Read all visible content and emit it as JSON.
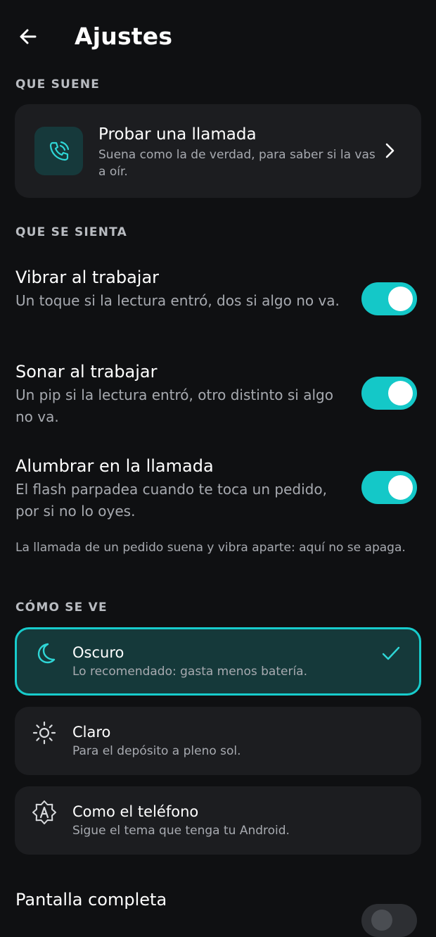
{
  "header": {
    "title": "Ajustes",
    "back_icon": "arrow-left-icon"
  },
  "sections": {
    "sound": "QUE SUENE",
    "feel": "QUE SE SIENTA",
    "look": "CÓMO SE VE"
  },
  "test_call": {
    "icon": "phone-ringing-icon",
    "title": "Probar una llamada",
    "subtitle": "Suena como la de verdad, para saber si la vas a oír."
  },
  "toggles": [
    {
      "title": "Vibrar al trabajar",
      "subtitle": "Un toque si la lectura entró, dos si algo no va.",
      "on": true
    },
    {
      "title": "Sonar al trabajar",
      "subtitle": "Un pip si la lectura entró, otro distinto si algo no va.",
      "on": true
    },
    {
      "title": "Alumbrar en la llamada",
      "subtitle": "El flash parpadea cuando te toca un pedido, por si no lo oyes.",
      "on": true
    }
  ],
  "note": "La llamada de un pedido suena y vibra aparte: aquí no se apaga.",
  "themes": [
    {
      "icon": "moon-icon",
      "title": "Oscuro",
      "subtitle": "Lo recomendado: gasta menos batería.",
      "selected": true
    },
    {
      "icon": "sun-icon",
      "title": "Claro",
      "subtitle": "Para el depósito a pleno sol.",
      "selected": false
    },
    {
      "icon": "auto-theme-icon",
      "title": "Como el teléfono",
      "subtitle": "Sigue el tema que tenga tu Android.",
      "selected": false
    }
  ],
  "fullscreen": {
    "title": "Pantalla completa",
    "on": false
  },
  "colors": {
    "accent": "#14c8c8",
    "background": "#0f1012",
    "card": "#1c1d20",
    "selected_card": "#15393a"
  }
}
